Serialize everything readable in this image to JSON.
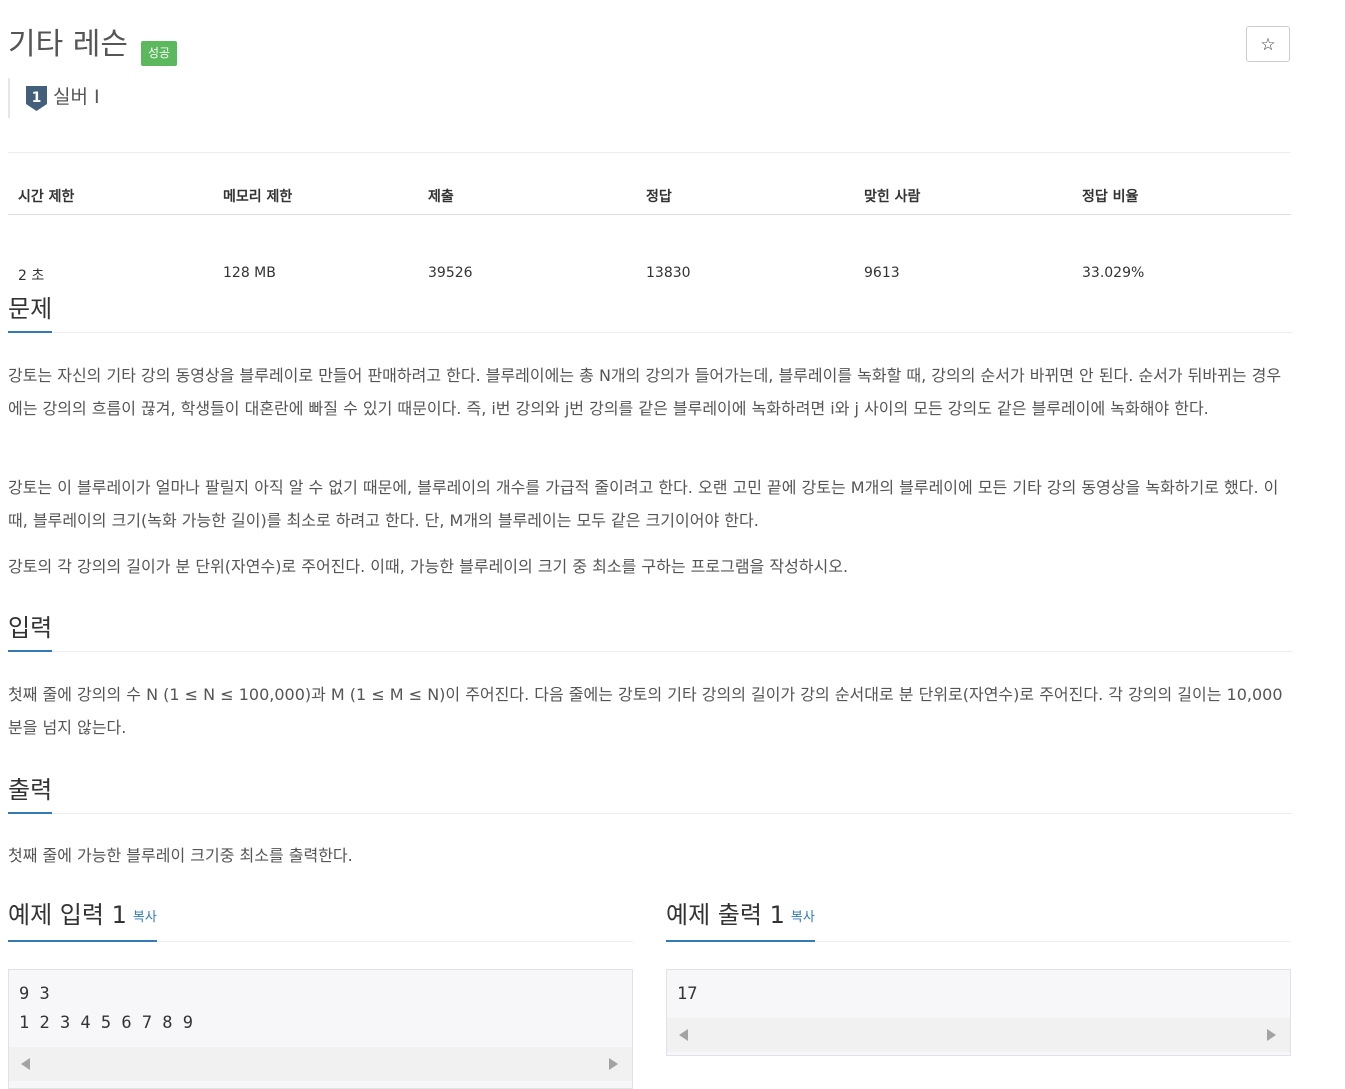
{
  "problem": {
    "title": "기타 레슨",
    "status_badge": "성공",
    "tier": {
      "label": "실버 I",
      "number": "1",
      "icon": "silver-tier-icon",
      "color": "#435f7a"
    },
    "star_icon": "star-icon",
    "star_glyph": "☆"
  },
  "stats": {
    "headers": [
      "시간 제한",
      "메모리 제한",
      "제출",
      "정답",
      "맞힌 사람",
      "정답 비율"
    ],
    "values": [
      "2 초",
      "128 MB",
      "39526",
      "13830",
      "9613",
      "33.029%"
    ]
  },
  "sections": {
    "description": {
      "heading": "문제",
      "paragraphs": [
        "강토는 자신의 기타 강의 동영상을 블루레이로 만들어 판매하려고 한다. 블루레이에는 총 N개의 강의가 들어가는데, 블루레이를 녹화할 때, 강의의 순서가 바뀌면 안 된다. 순서가 뒤바뀌는 경우에는 강의의 흐름이 끊겨, 학생들이 대혼란에 빠질 수 있기 때문이다. 즉, i번 강의와 j번 강의를 같은 블루레이에 녹화하려면 i와 j 사이의 모든 강의도 같은 블루레이에 녹화해야 한다.",
        "강토는 이 블루레이가 얼마나 팔릴지 아직 알 수 없기 때문에, 블루레이의 개수를 가급적 줄이려고 한다. 오랜 고민 끝에 강토는 M개의 블루레이에 모든 기타 강의 동영상을 녹화하기로 했다. 이때, 블루레이의 크기(녹화 가능한 길이)를 최소로 하려고 한다. 단, M개의 블루레이는 모두 같은 크기이어야 한다.",
        "강토의 각 강의의 길이가 분 단위(자연수)로 주어진다. 이때, 가능한 블루레이의 크기 중 최소를 구하는 프로그램을 작성하시오."
      ]
    },
    "input": {
      "heading": "입력",
      "text": "첫째 줄에 강의의 수 N (1 ≤ N ≤ 100,000)과 M (1 ≤ M ≤ N)이 주어진다. 다음 줄에는 강토의 기타 강의의 길이가 강의 순서대로 분 단위로(자연수)로 주어진다. 각 강의의 길이는 10,000분을 넘지 않는다."
    },
    "output": {
      "heading": "출력",
      "text": "첫째 줄에 가능한 블루레이 크기중 최소를 출력한다."
    }
  },
  "samples": {
    "input": {
      "heading": "예제 입력 1",
      "copy_label": "복사",
      "content": "9 3\n1 2 3 4 5 6 7 8 9"
    },
    "output": {
      "heading": "예제 출력 1",
      "copy_label": "복사",
      "content": "17"
    }
  },
  "colors": {
    "accent": "#337ab7",
    "success": "#5cb85c"
  }
}
